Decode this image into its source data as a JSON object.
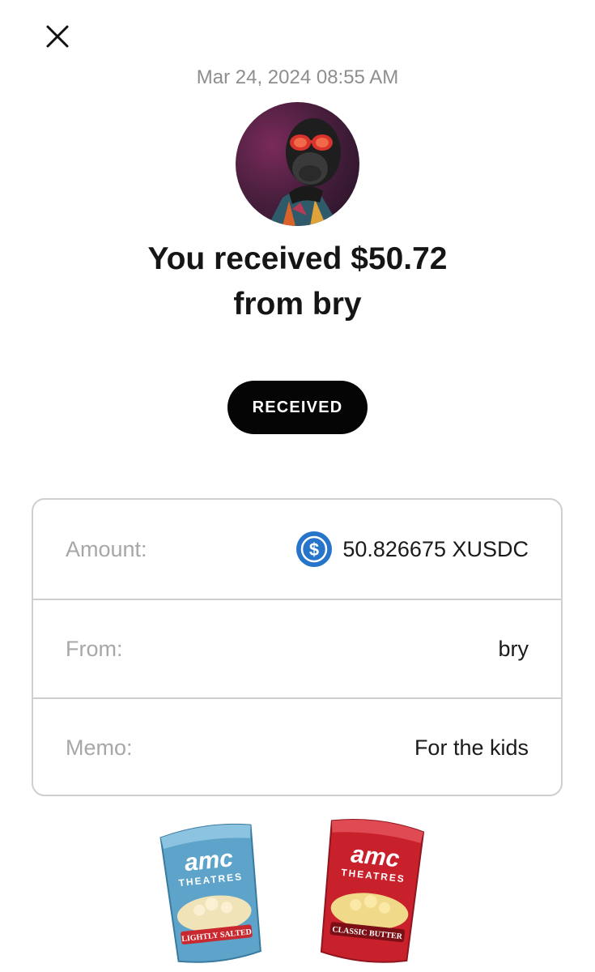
{
  "header": {
    "close_icon": "close-icon",
    "timestamp": "Mar 24, 2024 08:55 AM"
  },
  "sender": {
    "avatar_description": "gorilla-with-red-sunglasses"
  },
  "headline": {
    "line1": "You received $50.72",
    "line2": "from bry"
  },
  "status": {
    "label": "RECEIVED"
  },
  "details": {
    "amount_label": "Amount:",
    "amount_value": "50.826675 XUSDC",
    "amount_icon": "usdc-icon",
    "from_label": "From:",
    "from_value": "bry",
    "memo_label": "Memo:",
    "memo_value": "For the kids"
  },
  "stickers": [
    {
      "brand": "amc",
      "line2": "THEATRES",
      "flavor": "LIGHTLY SALTED",
      "color": "#4a8fb8"
    },
    {
      "brand": "amc",
      "line2": "THEATRES",
      "flavor": "CLASSIC BUTTER",
      "color": "#c0202a"
    }
  ],
  "colors": {
    "accent_pill": "#050505",
    "usdc_blue": "#2775ca",
    "border": "#cfcfcf",
    "label_gray": "#a7a7a7"
  }
}
